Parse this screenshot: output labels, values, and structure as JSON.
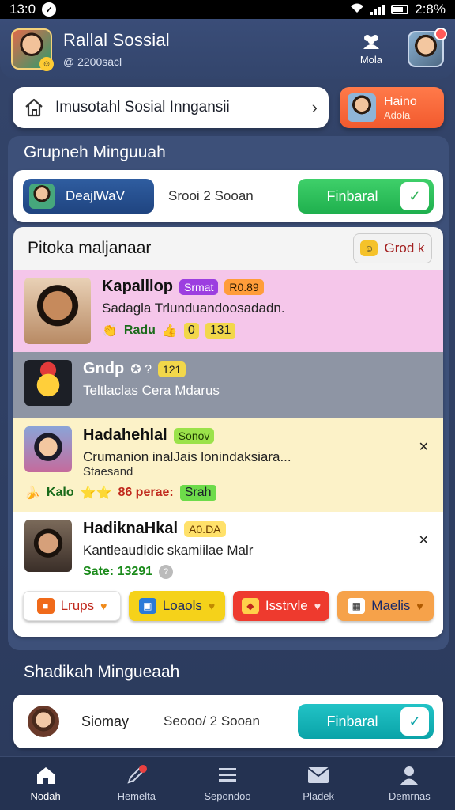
{
  "status": {
    "time_left": "13:0",
    "time_right": "2:8%"
  },
  "header": {
    "title": "Rallal Sossial",
    "handle": "@ 2200sacl",
    "menu_label": "Mola"
  },
  "search": {
    "text": "Imusotahl Sosial Inngansii"
  },
  "hello_card": {
    "line1": "Haino",
    "line2": "Adola"
  },
  "groups_section": {
    "title": "Grupneh Minguuah",
    "pill_label": "DeajlWaV",
    "subtitle": "Srooi 2 Sooan",
    "button_label": "Finbaral"
  },
  "feed": {
    "header": "Pitoka maljanaar",
    "grod_label": "Grod k",
    "posts": [
      {
        "name": "Kapalllop",
        "tag1": "Srmat",
        "tag2": "R0.89",
        "text": "Sadagla Trlunduandoosadadn.",
        "meta1": "Radu",
        "meta2": "0",
        "meta3": "131"
      },
      {
        "name": "Gndp",
        "tag1": "121",
        "text": "Teltlaclas Cera Mdarus"
      },
      {
        "name": "Hadahehlal",
        "tag1": "Sonov",
        "text": "Crumanion inalJais lonindaksiara...",
        "text2": "Staesand",
        "meta1": "Kalo",
        "meta2": "86 perae:",
        "meta3": "Srah"
      },
      {
        "name": "HadiknaHkal",
        "tag1": "A0.DA",
        "text": "Kantleaudidic skamiilae Malr",
        "text2": "Sate: 13291"
      }
    ],
    "chips": [
      "Lrups",
      "Loaols",
      "Isstrvle",
      "Maelis"
    ]
  },
  "second_section": {
    "title": "Shadikah Mingueaah",
    "name": "Siomay",
    "subtitle": "Seooo/ 2 Sooan",
    "button_label": "Finbaral"
  },
  "nav": {
    "items": [
      "Nodah",
      "Hemelta",
      "Sepondoo",
      "Pladek",
      "Demrnas"
    ]
  },
  "colors": {
    "accent_green": "#22b550",
    "accent_orange": "#f25a2e",
    "accent_teal": "#14b3b6",
    "post_pink": "#f5c6ea",
    "post_gray": "#8e95a4",
    "post_yellow": "#fcf2c8"
  }
}
